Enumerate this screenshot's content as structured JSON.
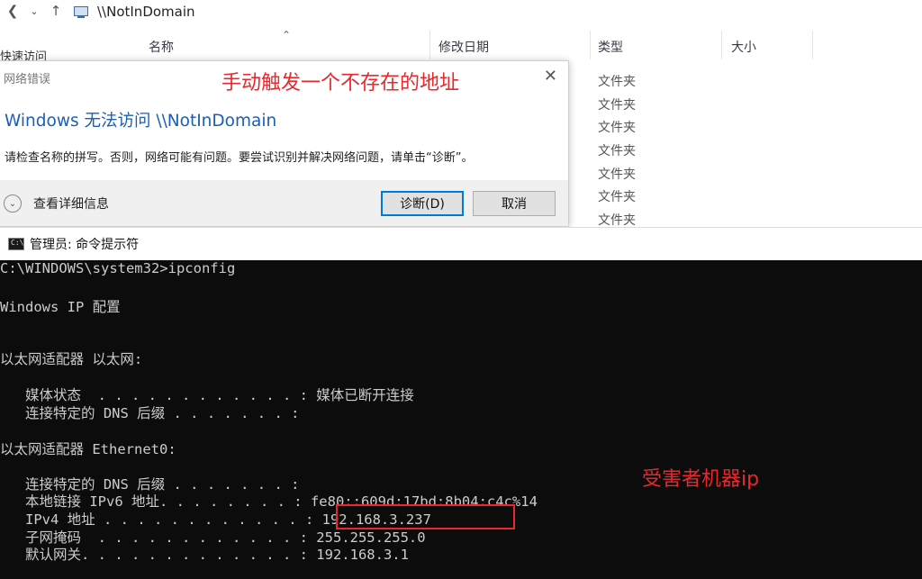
{
  "explorer": {
    "address": "\\\\NotInDomain",
    "left_clipped": "快速访问",
    "columns": {
      "name": "名称",
      "modified": "修改日期",
      "type": "类型",
      "size": "大小"
    },
    "type_values": [
      "文件夹",
      "文件夹",
      "文件夹",
      "文件夹",
      "文件夹",
      "文件夹",
      "文件夹"
    ]
  },
  "dialog": {
    "title": "网络错误",
    "heading": "Windows 无法访问 \\\\NotInDomain",
    "message": "请检查名称的拼写。否则，网络可能有问题。要尝试识别并解决网络问题，请单击“诊断”。",
    "details_label": "查看详细信息",
    "diagnose_button": "诊断(D)",
    "cancel_button": "取消"
  },
  "annotations": {
    "top": "手动触发一个不存在的地址",
    "victim": "受害者机器ip",
    "color": "#e8282d"
  },
  "cmd": {
    "title": "管理员: 命令提示符",
    "lines": [
      "C:\\WINDOWS\\system32>ipconfig",
      "Windows IP 配置",
      "以太网适配器 以太网:",
      "   媒体状态  . . . . . . . . . . . . : 媒体已断开连接",
      "   连接特定的 DNS 后缀 . . . . . . . :",
      "以太网适配器 Ethernet0:",
      "   连接特定的 DNS 后缀 . . . . . . . :",
      "   本地链接 IPv6 地址. . . . . . . . : fe80::609d:17bd:8b04:c4c%14",
      "   IPv4 地址 . . . . . . . . . . . . : 192.168.3.237",
      "   子网掩码  . . . . . . . . . . . . : 255.255.255.0",
      "   默认网关. . . . . . . . . . . . . : 192.168.3.1"
    ]
  }
}
